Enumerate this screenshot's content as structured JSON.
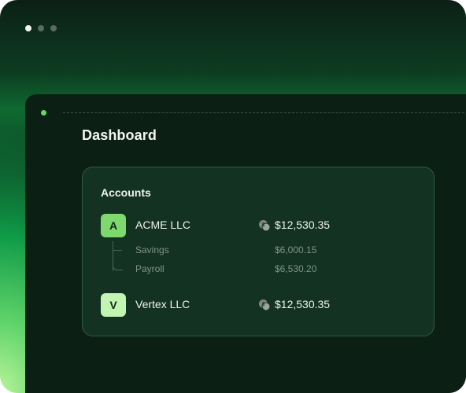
{
  "window": {
    "controls": [
      "close",
      "minimize",
      "maximize"
    ]
  },
  "page": {
    "title": "Dashboard"
  },
  "accounts": {
    "title": "Accounts",
    "items": [
      {
        "badge": "A",
        "name": "ACME LLC",
        "icon": "coins-icon",
        "amount": "$12,530.35",
        "sub_accounts": [
          {
            "name": "Savings",
            "amount": "$6,000.15"
          },
          {
            "name": "Payroll",
            "amount": "$6,530.20"
          }
        ]
      },
      {
        "badge": "V",
        "name": "Vertex LLC",
        "icon": "coins-icon",
        "amount": "$12,530.35",
        "sub_accounts": []
      }
    ]
  },
  "colors": {
    "accent_green": "#7ed86d",
    "badge_light": "#c2f5b1",
    "panel_bg": "#0c1f15",
    "card_bg": "#133222"
  }
}
